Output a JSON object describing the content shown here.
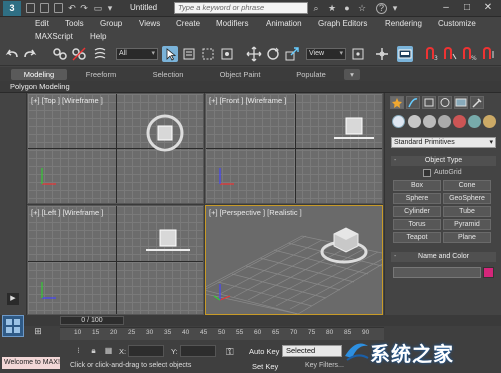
{
  "titlebar": {
    "logo": "3",
    "doc_title": "Untitled",
    "search_placeholder": "Type a keyword or phrase",
    "help": "?"
  },
  "menubar": {
    "items": [
      "Edit",
      "Tools",
      "Group",
      "Views",
      "Create",
      "Modifiers",
      "Animation",
      "Graph Editors",
      "Rendering",
      "Customize",
      "MAXScript",
      "Help"
    ]
  },
  "toolbar": {
    "filter_select": "All",
    "view_select": "View"
  },
  "ribbon": {
    "tabs": [
      "Modeling",
      "Freeform",
      "Selection",
      "Object Paint",
      "Populate"
    ],
    "active_tab": "Modeling",
    "subpanel": "Polygon Modeling"
  },
  "viewports": {
    "top": "[+] [Top ] [Wireframe ]",
    "front": "[+] [Front ] [Wireframe ]",
    "left": "[+] [Left ] [Wireframe ]",
    "perspective": "[+] [Perspective ] [Realistic ]"
  },
  "command_panel": {
    "category": "Standard Primitives",
    "object_type_header": "Object Type",
    "autogrid": "AutoGrid",
    "buttons": [
      "Box",
      "Cone",
      "Sphere",
      "GeoSphere",
      "Cylinder",
      "Tube",
      "Torus",
      "Pyramid",
      "Teapot",
      "Plane"
    ],
    "name_color_header": "Name and Color",
    "object_color": "#d4267a"
  },
  "timeline": {
    "frame_display": "0 / 100",
    "ticks": [
      "10",
      "15",
      "20",
      "25",
      "30",
      "35",
      "40",
      "45",
      "50",
      "55",
      "60",
      "65",
      "70",
      "75",
      "80",
      "85",
      "90"
    ]
  },
  "status": {
    "script_listener": "Welcome to MAX!",
    "prompt": "Click or click-and-drag to select objects",
    "x_label": "X:",
    "y_label": "Y:",
    "auto_key": "Auto Key",
    "set_key": "Set Key",
    "key_mode": "Selected",
    "key_filters": "Key Filters..."
  },
  "watermark": {
    "text": "系统之家"
  }
}
